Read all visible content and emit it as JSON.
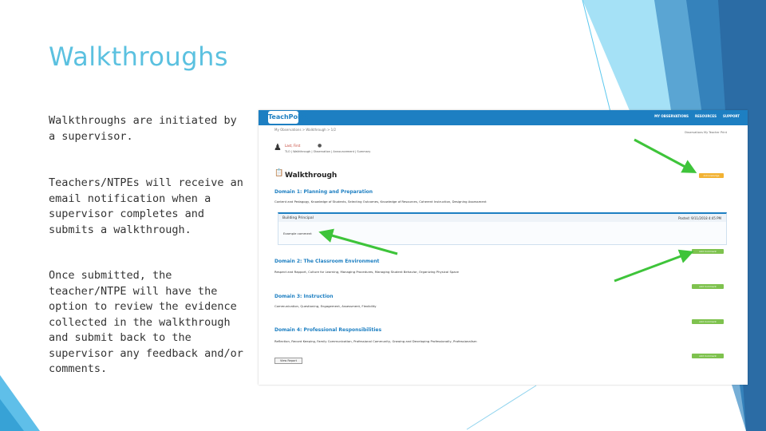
{
  "slide": {
    "title": "Walkthroughs",
    "paragraphs": [
      "Walkthroughs are initiated by a supervisor.",
      "Teachers/NTPEs will receive an email notification when a supervisor completes and submits a walkthrough.",
      "Once submitted, the teacher/NTPE will have the option to review the evidence collected in the walkthrough and submit back to the supervisor any feedback and/or comments."
    ],
    "accent_colors": {
      "title": "#5bc1e0",
      "arrows": "#3ec43a",
      "deco_blue": "#29aae2",
      "deco_dark": "#2b6ca5"
    }
  },
  "screenshot": {
    "logo": "TeachPoint",
    "nav": [
      "MY OBSERVATIONS",
      "RESOURCES",
      "SUPPORT"
    ],
    "breadcrumb": "My Observations > Walkthrough > 1/2",
    "right_links": "Observations   My Teacher   Print",
    "user_name": "Last, First",
    "user_tabs": "TLO  |  Walkthrough  |  Observation  |  Announcement  |  Summary",
    "heading": "Walkthrough",
    "orange_button": "Acknowledge",
    "domains": [
      {
        "title": "Domain 1: Planning and Preparation",
        "text": "Content and Pedagogy, Knowledge of Students, Selecting Outcomes, Knowledge of Resources, Coherent Instruction, Designing Assessment"
      },
      {
        "title": "Domain 2: The Classroom Environment",
        "text": "Respect and Rapport, Culture for Learning, Managing Procedures, Managing Student Behavior, Organizing Physical Space"
      },
      {
        "title": "Domain 3: Instruction",
        "text": "Communication, Questioning, Engagement, Assessment, Flexibility"
      },
      {
        "title": "Domain 4: Professional Responsibilities",
        "text": "Reflection, Record Keeping, Family Communication, Professional Community, Growing and Developing Professionally, Professionalism"
      }
    ],
    "panel": {
      "author": "Building Principal",
      "posted": "Posted: 9/11/2018   4:45 PM",
      "evidence": "Example comment"
    },
    "add_comment_label": "Add Comment",
    "view_report_label": "View Report"
  }
}
